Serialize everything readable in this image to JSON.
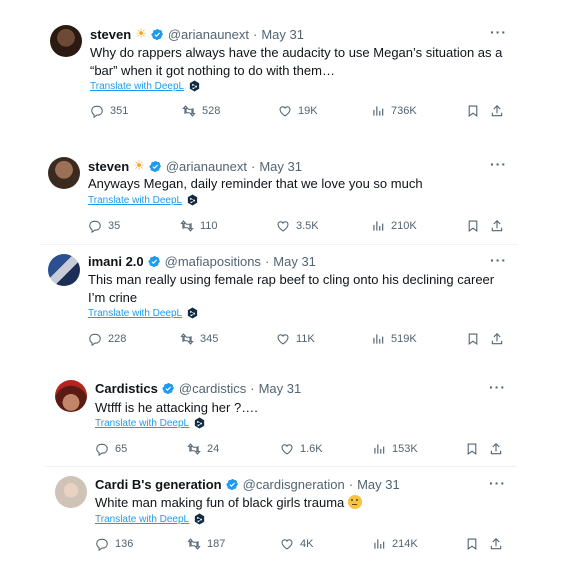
{
  "tweets": [
    {
      "name": "steven",
      "name_emoji": "☀",
      "handle": "@arianaunext",
      "sep": "·",
      "date": "May 31",
      "text": "Why do rappers always have the audacity to use Megan’s situation as a “bar” when it got nothing to do with them…",
      "translate": "Translate with DeepL",
      "replies": "351",
      "retweets": "528",
      "likes": "19K",
      "views": "736K"
    },
    {
      "name": "steven",
      "name_emoji": "☀",
      "handle": "@arianaunext",
      "sep": "·",
      "date": "May 31",
      "text": "Anyways Megan, daily reminder that we love you so much",
      "translate": "Translate with DeepL",
      "replies": "35",
      "retweets": "110",
      "likes": "3.5K",
      "views": "210K"
    },
    {
      "name": "imani 2.0",
      "handle": "@mafiapositions",
      "sep": "·",
      "date": "May 31",
      "text": "This man really using female rap beef to cling onto his declining career I’m crine",
      "translate": "Translate with DeepL",
      "replies": "228",
      "retweets": "345",
      "likes": "11K",
      "views": "519K"
    },
    {
      "name": "Cardistics",
      "handle": "@cardistics",
      "sep": "·",
      "date": "May 31",
      "text": "Wtfff is he attacking her ?….",
      "translate": "Translate with DeepL",
      "replies": "65",
      "retweets": "24",
      "likes": "1.6K",
      "views": "153K"
    },
    {
      "name": "Cardi B's generation",
      "handle": "@cardisgneration",
      "sep": "·",
      "date": "May 31",
      "text": "White man making fun of black girls trauma",
      "translate": "Translate with DeepL",
      "replies": "136",
      "retweets": "187",
      "likes": "4K",
      "views": "214K"
    }
  ],
  "colors": {
    "accent": "#1d9bf0",
    "muted": "#536471",
    "text": "#0f1419"
  },
  "icons": [
    "verified-icon",
    "more-icon",
    "reply-icon",
    "retweet-icon",
    "like-icon",
    "views-icon",
    "bookmark-icon",
    "share-icon",
    "deepl-icon"
  ]
}
